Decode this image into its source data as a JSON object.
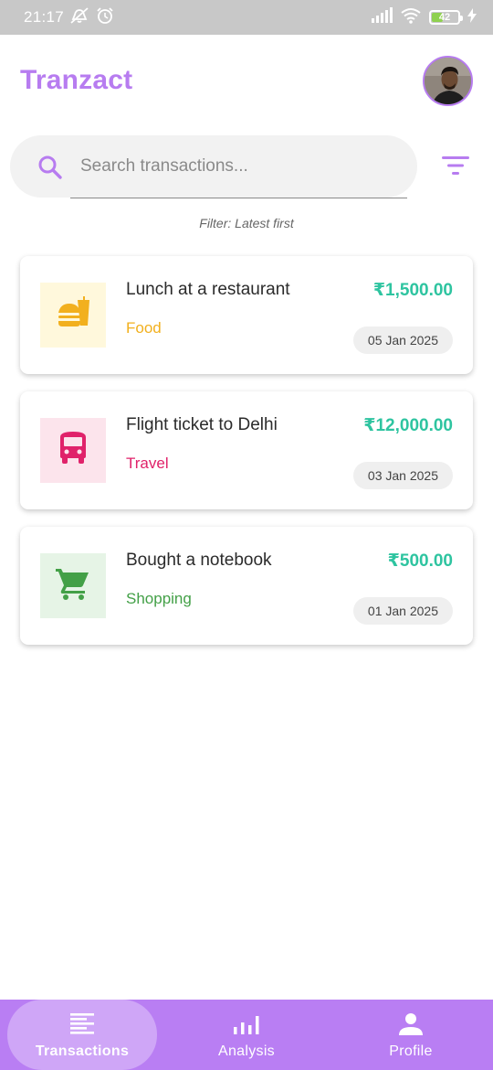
{
  "status_bar": {
    "time": "21:17",
    "battery": "42",
    "battery_level": 0.42,
    "icons": [
      "mute-icon",
      "alarm-icon",
      "signal-icon",
      "wifi-icon",
      "battery-icon",
      "charging-icon"
    ]
  },
  "header": {
    "title": "Tranzact",
    "avatar": "profile-avatar"
  },
  "search": {
    "placeholder": "Search transactions...",
    "value": ""
  },
  "filter": {
    "label": "Filter: Latest first",
    "icon": "filter-icon"
  },
  "transactions": [
    {
      "title": "Lunch at a restaurant",
      "category": "Food",
      "amount": "₹1,500.00",
      "date": "05 Jan 2025",
      "icon": "fastfood-icon",
      "category_color": "#f2b01e",
      "tile_color": "#fff8dc"
    },
    {
      "title": "Flight ticket to Delhi",
      "category": "Travel",
      "amount": "₹12,000.00",
      "date": "03 Jan 2025",
      "icon": "bus-icon",
      "category_color": "#e0226a",
      "tile_color": "#fce4ec"
    },
    {
      "title": "Bought a notebook",
      "category": "Shopping",
      "amount": "₹500.00",
      "date": "01 Jan 2025",
      "icon": "shopping-cart-icon",
      "category_color": "#43a047",
      "tile_color": "#e6f4e6"
    }
  ],
  "bottom_nav": {
    "items": [
      {
        "label": "Transactions",
        "icon": "list-icon",
        "active": true
      },
      {
        "label": "Analysis",
        "icon": "bar-chart-icon",
        "active": false
      },
      {
        "label": "Profile",
        "icon": "person-icon",
        "active": false
      }
    ]
  },
  "colors": {
    "accent": "#b77cf0",
    "amount": "#2ec4a0",
    "nav_background": "#b97ef3"
  }
}
